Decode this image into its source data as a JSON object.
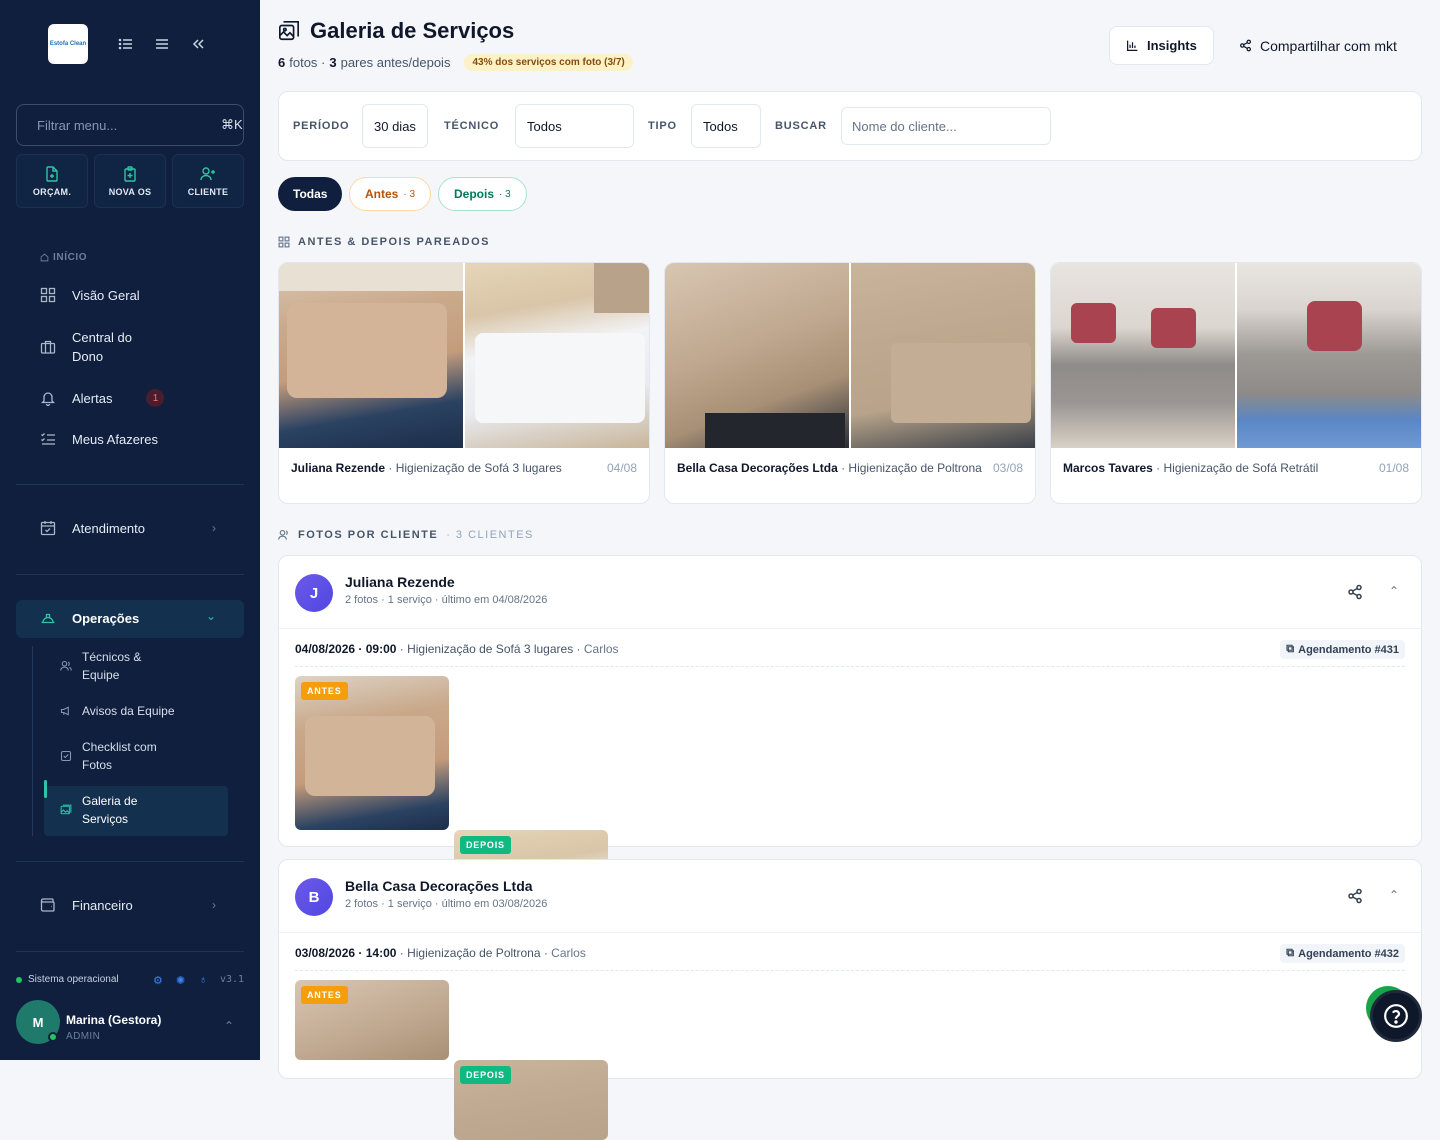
{
  "sidebar": {
    "logo_text": "Estofa Clean",
    "search_placeholder": "Filtrar menu...",
    "search_shortcut": "⌘K",
    "quick_actions": [
      "ORÇAM.",
      "NOVA OS",
      "CLIENTE"
    ],
    "section_inicio": "INÍCIO",
    "nav": {
      "visao_geral": "Visão Geral",
      "central_dono_1": "Central do",
      "central_dono_2": "Dono",
      "alertas": "Alertas",
      "alertas_badge": "1",
      "afazeres": "Meus Afazeres",
      "atendimento": "Atendimento",
      "operacoes": "Operações",
      "financeiro": "Financeiro"
    },
    "sub": {
      "tecnicos_1": "Técnicos &",
      "tecnicos_2": "Equipe",
      "avisos": "Avisos da Equipe",
      "checklist_1": "Checklist com",
      "checklist_2": "Fotos",
      "galeria_1": "Galeria de",
      "galeria_2": "Serviços"
    },
    "status": "Sistema operacional",
    "version": "v3.1",
    "user": {
      "initial": "M",
      "name": "Marina (Gestora)",
      "role": "ADMIN"
    }
  },
  "header": {
    "title": "Galeria de Serviços",
    "photos_count": "6",
    "photos_label": "fotos ·",
    "pairs_count": "3",
    "pairs_label": "pares antes/depois",
    "coverage_pill": "43% dos serviços com foto (3/7)",
    "insights": "Insights",
    "share": "Compartilhar com mkt"
  },
  "filters": {
    "periodo_label": "PERÍODO",
    "periodo_value": "30 dias",
    "tecnico_label": "TÉCNICO",
    "tecnico_value": "Todos",
    "tipo_label": "TIPO",
    "tipo_value": "Todos",
    "buscar_label": "BUSCAR",
    "buscar_placeholder": "Nome do cliente..."
  },
  "chips": {
    "todas": "Todas",
    "antes": "Antes",
    "antes_count": "· 3",
    "depois": "Depois",
    "depois_count": "· 3"
  },
  "pairs_section": "ANTES & DEPOIS PAREADOS",
  "pairs": [
    {
      "client": "Juliana Rezende",
      "service": " · Higienização de Sofá 3 lugares",
      "date": "04/08"
    },
    {
      "client": "Bella Casa Decorações Ltda",
      "service": " · Higienização de Poltrona",
      "date": "03/08"
    },
    {
      "client": "Marcos Tavares",
      "service": " · Higienização de Sofá Retrátil",
      "date": "01/08"
    }
  ],
  "clients_section": "FOTOS POR CLIENTE",
  "clients_count": "· 3 CLIENTES",
  "clients": [
    {
      "initial": "J",
      "name": "Juliana Rezende",
      "meta": "2 fotos · 1 serviço · último em 04/08/2026",
      "datetime": "04/08/2026 · 09:00",
      "service": " · Higienização de Sofá 3 lugares · ",
      "tech": "Carlos",
      "appointment": "Agendamento #431"
    },
    {
      "initial": "B",
      "name": "Bella Casa Decorações Ltda",
      "meta": "2 fotos · 1 serviço · último em 03/08/2026",
      "datetime": "03/08/2026 · 14:00",
      "service": " · Higienização de Poltrona · ",
      "tech": "Carlos",
      "appointment": "Agendamento #432"
    }
  ],
  "tags": {
    "antes": "ANTES",
    "depois": "DEPOIS"
  },
  "colors": {
    "sidebar": "#0f1f3d",
    "accent": "#2ec4a6",
    "antes": "#f59e0b",
    "depois": "#10b981"
  }
}
